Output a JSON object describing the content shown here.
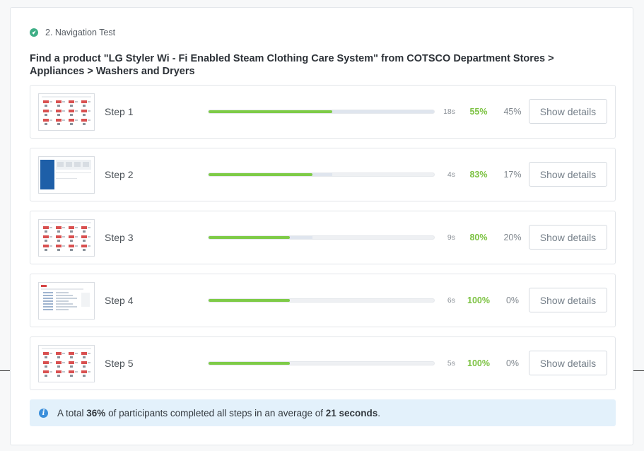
{
  "section": {
    "title": "2. Navigation Test",
    "task": "Find a product \"LG Styler Wi - Fi Enabled Steam Clothing Care System\" from COTSCO Department Stores > Appliances > Washers and Dryers"
  },
  "steps": [
    {
      "label": "Step 1",
      "time": "18s",
      "success": "55%",
      "fail": "45%",
      "success_fraction": 0.55,
      "total_fraction": 1.0,
      "button": "Show details",
      "thumb": "grid"
    },
    {
      "label": "Step 2",
      "time": "4s",
      "success": "83%",
      "fail": "17%",
      "success_fraction": 0.46,
      "total_fraction": 0.55,
      "button": "Show details",
      "thumb": "sidebar"
    },
    {
      "label": "Step 3",
      "time": "9s",
      "success": "80%",
      "fail": "20%",
      "success_fraction": 0.36,
      "total_fraction": 0.46,
      "button": "Show details",
      "thumb": "grid"
    },
    {
      "label": "Step 4",
      "time": "6s",
      "success": "100%",
      "fail": "0%",
      "success_fraction": 0.36,
      "total_fraction": 0.36,
      "button": "Show details",
      "thumb": "list"
    },
    {
      "label": "Step 5",
      "time": "5s",
      "success": "100%",
      "fail": "0%",
      "success_fraction": 0.36,
      "total_fraction": 0.36,
      "button": "Show details",
      "thumb": "grid"
    }
  ],
  "summary": {
    "prefix": "A total ",
    "percent": "36%",
    "middle": " of participants completed all steps in an average of ",
    "duration": "21 seconds",
    "suffix": "."
  },
  "colors": {
    "accent_green": "#7cc242",
    "bar_green": "#7ecb47",
    "check_badge": "#3fae86",
    "info_blue": "#3b8fdb",
    "summary_bg": "#e3f1fb"
  },
  "icons": {
    "section": "check-badge-icon",
    "summary": "info-icon"
  }
}
